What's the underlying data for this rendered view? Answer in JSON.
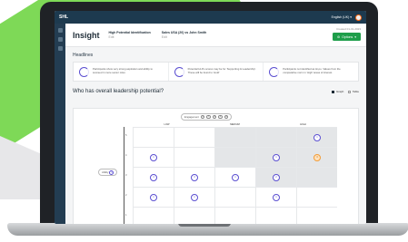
{
  "brand_colors": {
    "green": "#7ed957",
    "accent": "#5b4fd1",
    "ok": "#1e9e4a",
    "warn": "#f29d38"
  },
  "topbar": {
    "logo": "SHL",
    "language": "English (UK) ▾"
  },
  "header": {
    "title": "Insight",
    "cols": [
      {
        "label": "High Potential Identification",
        "sub": "Edit"
      },
      {
        "label": "Sales USA (20) vs John Smith",
        "sub": "Edit"
      }
    ],
    "date": "Created 01-01-2023",
    "options_label": "Options"
  },
  "headlines": {
    "title": "Headlines",
    "items": [
      {
        "text": "Participants show very strong aspiration and ability to succeed in more senior roles"
      },
      {
        "text": "Potential Hi-Po scores may be for ‘Supporting & Leadership’. These will be found to ‘Hold’"
      },
      {
        "text": "Participants not identified as Hi-po. Values from the comparative norm in ‘High’ areas of interest."
      }
    ]
  },
  "question": "Who has overall leadership potential?",
  "views": {
    "graph": "Graph",
    "table": "Table"
  },
  "engagement": {
    "label": "Engagement",
    "levels": [
      "1",
      "2",
      "3",
      "4",
      "5"
    ]
  },
  "ability": {
    "label": "Ability",
    "badge": "1"
  },
  "grid": {
    "columns": [
      "LOW",
      "MEDIUM",
      "HIGH"
    ],
    "rows": [
      {
        "label": "5",
        "cells": [
          "",
          "",
          "",
          "",
          "1"
        ]
      },
      {
        "label": "4",
        "cells": [
          "1",
          "",
          "",
          "1",
          "3"
        ]
      },
      {
        "label": "3",
        "cells": [
          "4",
          "3",
          "1",
          "2",
          ""
        ]
      },
      {
        "label": "2",
        "cells": [
          "1",
          "1",
          "",
          "1",
          ""
        ]
      },
      {
        "label": "1",
        "cells": [
          "",
          "",
          "",
          "",
          ""
        ]
      }
    ]
  }
}
